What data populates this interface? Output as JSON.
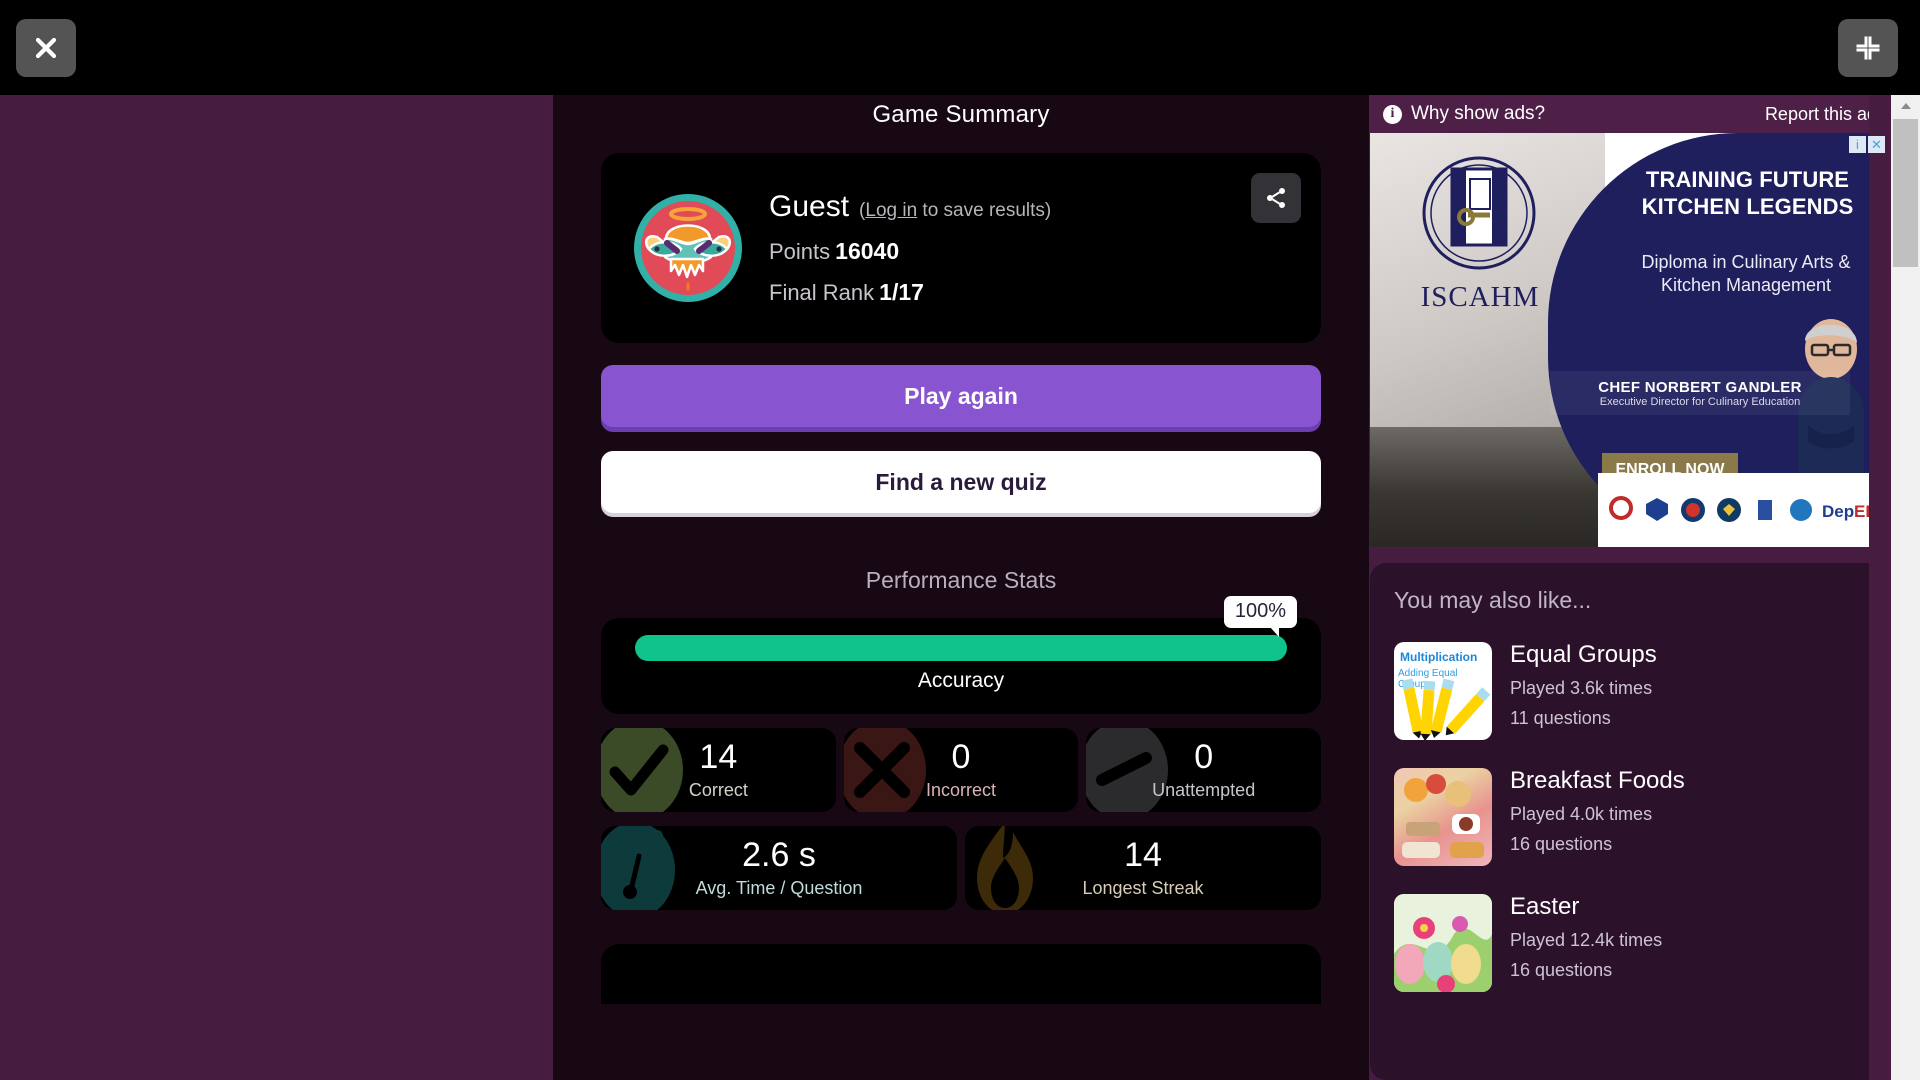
{
  "chrome": {
    "close_label": "close-window",
    "fullscreen_label": "exit-fullscreen"
  },
  "main": {
    "title": "Game Summary",
    "player": {
      "name": "Guest",
      "login_prefix": "(",
      "login_link": "Log in",
      "login_suffix": " to save results)",
      "points_label": "Points",
      "points_value": "16040",
      "rank_label": "Final Rank",
      "rank_value": "1/17"
    },
    "share_label": "Share",
    "buttons": {
      "play_again": "Play again",
      "find_new_quiz": "Find a new quiz"
    },
    "performance": {
      "title": "Performance Stats",
      "accuracy": {
        "label": "Accuracy",
        "percent_label": "100%",
        "percent_value": 100,
        "bar_color": "#0fc38a"
      },
      "stats": [
        {
          "value": "14",
          "label": "Correct",
          "blob_color": "#3b4a27",
          "label_color": "#cfd6c5",
          "icon": "check-icon"
        },
        {
          "value": "0",
          "label": "Incorrect",
          "blob_color": "#3a1614",
          "label_color": "#d9b5b6",
          "icon": "cross-icon"
        },
        {
          "value": "0",
          "label": "Unattempted",
          "blob_color": "#2b2b2e",
          "label_color": "#c7c4cb",
          "icon": "dash-icon"
        },
        {
          "value": "2.6 s",
          "label": "Avg. Time / Question",
          "blob_color": "#0d3a3a",
          "label_color": "#bfdbdb",
          "icon": "stopwatch-icon"
        },
        {
          "value": "14",
          "label": "Longest Streak",
          "blob_color": "#3d2a08",
          "label_color": "#d7cdb8",
          "icon": "flame-icon"
        }
      ]
    }
  },
  "ads": {
    "why_show_ads": "Why show ads?",
    "report_this_ad": "Report this ad",
    "info_glyph": "i",
    "banner": {
      "brand": "ISCAHM",
      "headline": "TRAINING FUTURE KITCHEN LEGENDS",
      "subhead": "Diploma in Culinary Arts & Kitchen Management",
      "chef_name": "CHEF NORBERT GANDLER",
      "chef_role": "Executive Director for Culinary Education",
      "cta": "ENROLL NOW",
      "ctrl_info": "i",
      "ctrl_close": "✕"
    }
  },
  "suggestions": {
    "title": "You may also like...",
    "items": [
      {
        "name": "Equal Groups",
        "played": "Played 3.6k times",
        "questions": "11 questions",
        "thumb_title": "Multiplication",
        "thumb_sub": "Adding Equal Groups",
        "thumb_kind": "th-mult"
      },
      {
        "name": "Breakfast Foods",
        "played": "Played 4.0k times",
        "questions": "16 questions",
        "thumb_title": "",
        "thumb_sub": "",
        "thumb_kind": "th-break"
      },
      {
        "name": "Easter",
        "played": "Played 12.4k times",
        "questions": "16 questions",
        "thumb_title": "",
        "thumb_sub": "",
        "thumb_kind": "th-east"
      }
    ]
  },
  "theme": {
    "page_purple": "#471C41",
    "center_bg": "#180813",
    "card_black": "#000000",
    "primary_purple": "#8854d0",
    "accent_green": "#0fc38a"
  }
}
